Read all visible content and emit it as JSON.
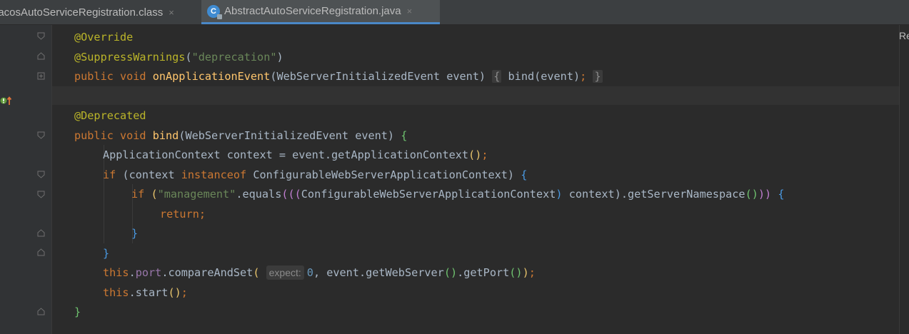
{
  "tabs": [
    {
      "label": "lacosAutoServiceRegistration.class",
      "close": "×",
      "active": false
    },
    {
      "label": "AbstractAutoServiceRegistration.java",
      "close": "×",
      "active": true,
      "icon_letter": "C"
    }
  ],
  "right_panel": {
    "label": "Re"
  },
  "hints": {
    "expect": "expect:"
  },
  "colors": {
    "keyword": "#cc7832",
    "annotation": "#bbb529",
    "string": "#6a8759",
    "method": "#ffc66d",
    "field": "#9876aa",
    "number": "#6897bb",
    "active_tab_underline": "#4a88c7"
  },
  "code": {
    "l1": {
      "annotation": "@Override"
    },
    "l2": {
      "annotation": "@SuppressWarnings",
      "p_open": "(",
      "string": "\"deprecation\"",
      "p_close": ")"
    },
    "l3": {
      "kw": "public void ",
      "method": "onApplicationEvent",
      "params": "(WebServerInitializedEvent event)",
      "fold_open": "{",
      "body": " bind(event)",
      "semi": ";",
      "fold_close": "}"
    },
    "l5": {
      "annotation": "@Deprecated"
    },
    "l6": {
      "kw": "public void ",
      "method": "bind",
      "params": "(WebServerInitializedEvent event) ",
      "brace": "{"
    },
    "l7": {
      "text": "ApplicationContext context = event.getApplicationContext",
      "parens": "()",
      "semi": ";"
    },
    "l8": {
      "kw": "if ",
      "open": "(context ",
      "kw2": "instanceof",
      "rest": " ConfigurableWebServerApplicationContext) ",
      "brace": "{"
    },
    "l9": {
      "kw": "if ",
      "p1": "(",
      "string": "\"management\"",
      "t1": ".equals",
      "p2": "(((",
      "t2": "ConfigurableWebServerApplicationContext",
      "p3": ")",
      "t3": " context)",
      "t4": ".getServerNamespace",
      "p4": "()",
      "p5": "))",
      "t5": " ",
      "brace": "{"
    },
    "l10": {
      "kw": "return",
      "semi": ";"
    },
    "l11": {
      "brace": "}"
    },
    "l12": {
      "brace": "}"
    },
    "l13": {
      "kw": "this",
      "dot": ".",
      "field": "port",
      "call": ".compareAndSet",
      "p1": "(",
      "num": "0",
      "rest": ", event.getWebServer",
      "p2": "()",
      "t2": ".getPort",
      "p3": "()",
      "p4": ")",
      "semi": ";"
    },
    "l14": {
      "kw": "this",
      "call": ".start",
      "p1": "()",
      "semi": ";"
    },
    "l15": {
      "brace": "}"
    }
  }
}
